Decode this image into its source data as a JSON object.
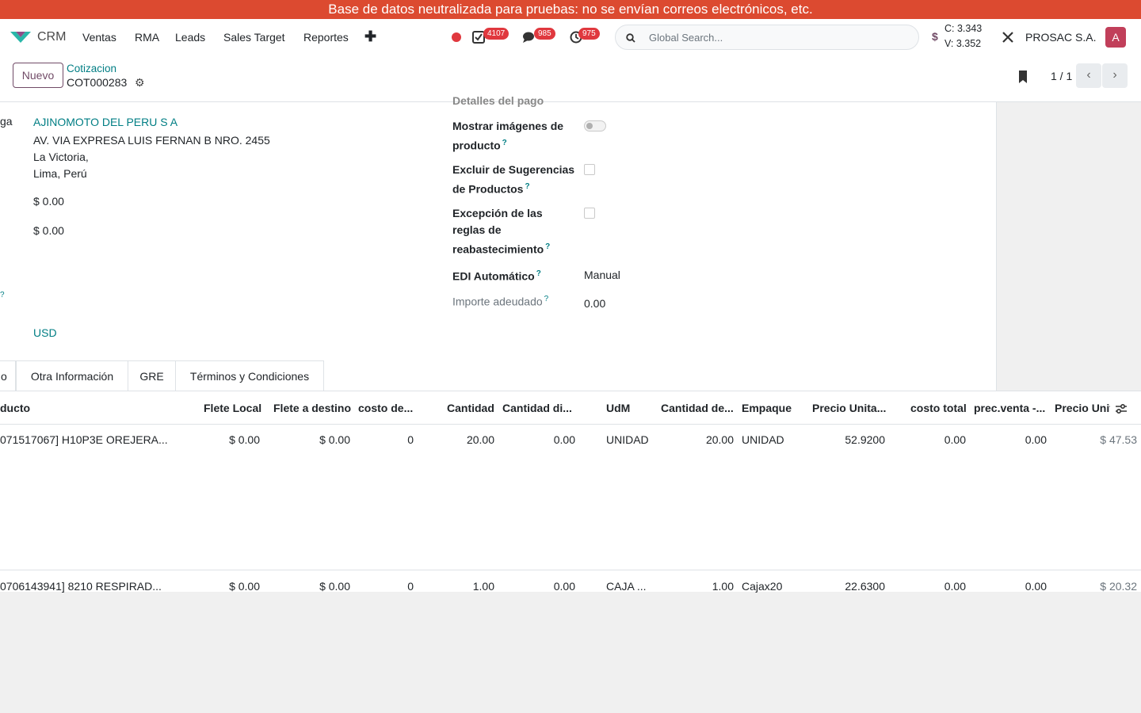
{
  "banner": "Base de datos neutralizada para pruebas: no se envían correos electrónicos, etc.",
  "nav": {
    "app": "CRM",
    "menu": [
      "Ventas",
      "RMA",
      "Leads",
      "Sales Target",
      "Reportes"
    ],
    "badges": {
      "activities": "4107",
      "messages": "985",
      "clock": "975"
    },
    "search_placeholder": "Global Search...",
    "rate_c": "C: 3.343",
    "rate_v": "V: 3.352",
    "currency_symbol": "$",
    "company": "PROSAC S.A.",
    "avatar": "A"
  },
  "control": {
    "new_button": "Nuevo",
    "breadcrumb_parent": "Cotizacion",
    "breadcrumb_current": "COT000283",
    "pager": "1 / 1"
  },
  "form": {
    "left_label_partial": "ga",
    "partner": "AJINOMOTO DEL PERU S A",
    "address": [
      "AV. VIA EXPRESA LUIS FERNAN B NRO. 2455",
      "La Victoria,",
      "Lima, Perú"
    ],
    "amount1": "$ 0.00",
    "amount2": "$ 0.00",
    "partial_sup": "?",
    "currency": "USD",
    "cut_heading": "Detalles del pago",
    "fields": {
      "show_images": "Mostrar imágenes de producto",
      "exclude_suggestions": "Excluir de Sugerencias de Productos",
      "exception_rules": "Excepción de las reglas de reabastecimiento",
      "edi_label": "EDI Automático",
      "edi_value": "Manual",
      "amount_due_label": "Importe adeudado",
      "amount_due_value": "0.00"
    }
  },
  "tabs": [
    "o",
    "Otra Información",
    "GRE",
    "Términos y Condiciones"
  ],
  "table": {
    "headers": [
      "ducto",
      "Flete Local",
      "Flete a destino",
      "costo de...",
      "Cantidad",
      "Cantidad di...",
      "UdM",
      "Cantidad de...",
      "Empaque",
      "Precio Unita...",
      "costo total",
      "prec.venta -...",
      "Precio Unit"
    ],
    "rows": [
      [
        "071517067] H10P3E OREJERA...",
        "$ 0.00",
        "$ 0.00",
        "0",
        "20.00",
        "0.00",
        "UNIDAD",
        "20.00",
        "UNIDAD",
        "52.9200",
        "0.00",
        "0.00",
        "$ 47.53"
      ],
      [
        "0706143941] 8210 RESPIRAD...",
        "$ 0.00",
        "$ 0.00",
        "0",
        "1.00",
        "0.00",
        "CAJA ...",
        "1.00",
        "Cajax20",
        "22.6300",
        "0.00",
        "0.00",
        "$ 20.32"
      ]
    ]
  }
}
